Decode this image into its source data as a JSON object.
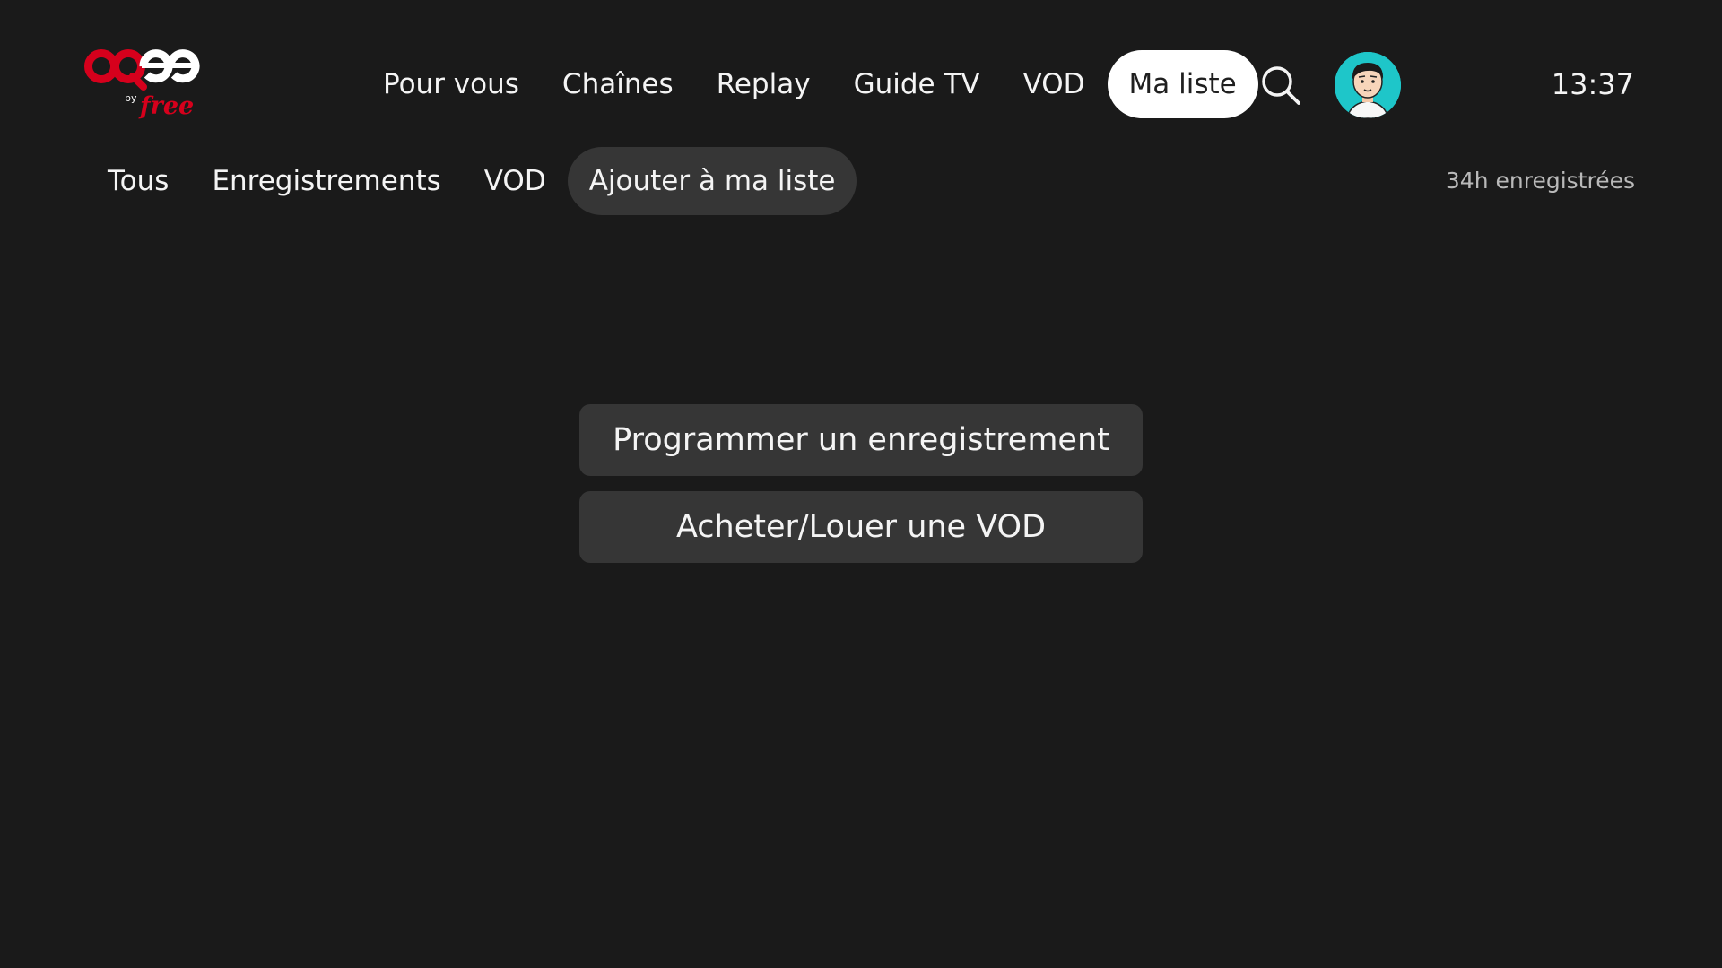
{
  "brand": {
    "logo_text": "oqee",
    "logo_by": "by",
    "logo_free": "free",
    "accent_red": "#d6001c"
  },
  "top_nav": {
    "items": [
      {
        "label": "Pour vous"
      },
      {
        "label": "Chaînes"
      },
      {
        "label": "Replay"
      },
      {
        "label": "Guide TV"
      },
      {
        "label": "VOD"
      },
      {
        "label": "Ma liste",
        "active": true
      }
    ],
    "search_icon": "search-icon",
    "avatar_icon": "user-avatar",
    "clock": "13:37"
  },
  "sub_tabs": {
    "items": [
      {
        "label": "Tous"
      },
      {
        "label": "Enregistrements"
      },
      {
        "label": "VOD"
      },
      {
        "label": "Ajouter à ma liste",
        "focused": true
      }
    ],
    "storage_info": "34h enregistrées"
  },
  "actions": {
    "program_recording": "Programmer un enregistrement",
    "buy_rent_vod": "Acheter/Louer une VOD"
  },
  "colors": {
    "background": "#1a1a1a",
    "button_bg": "#363636",
    "active_pill_bg": "#ffffff",
    "avatar_bg": "#1ec6c9"
  }
}
